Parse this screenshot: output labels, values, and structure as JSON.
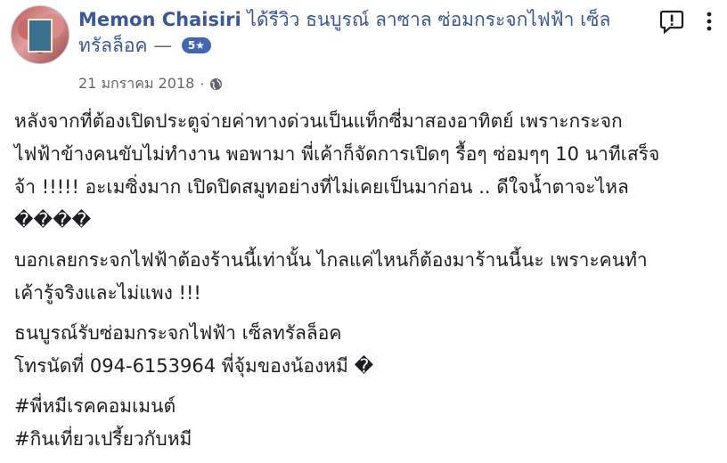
{
  "post": {
    "author_name": "Memon Chaisiri",
    "review_prefix": "ได้รีวิว ธนบูรณ์ ลาซาล ซ่อมกระจกไฟฟ้า เซ็ล",
    "review_suffix": "ทรัลล็อค",
    "rating_dash": "—",
    "rating_badge": "5★",
    "date": "21 มกราคม 2018",
    "dot": "·",
    "privacy_icon": "globe-icon",
    "report_icon": "report-icon",
    "more_icon": "more-vertical-icon"
  },
  "body": {
    "paragraph1": [
      "หลังจากที่ต้องเปิดประตูจ่ายค่าทางด่วนเป็นแท็กซี่มาสองอาทิตย์ เพราะกระจก",
      "ไฟฟ้าข้างคนขับไม่ทำงาน พอพามา พี่เค้าก็จัดการเปิดๆ รื้อๆ ซ่อมๆๆ 10 นาทีเสร็จ",
      "จ้า !!!!! อะเมซิ่งมาก เปิดปิดสมูทอย่างที่ไม่เคยเป็นมาก่อน .. ดีใจน้ำตาจะไหล",
      "����"
    ],
    "paragraph2": [
      "บอกเลยกระจกไฟฟ้าต้องร้านนี้เท่านั้น ไกลแค่ไหนก็ต้องมาร้านนี้นะ เพราะคนทำ",
      "เค้ารู้จริงและไม่แพง !!!"
    ],
    "paragraph3": [
      "ธนบูรณ์รับซ่อมกระจกไฟฟ้า เซ็ลทรัลล็อค",
      "โทรนัดที่ 094-6153964 พี่จุ้มของน้องหมี �"
    ],
    "hashtags": [
      "#พี่หมีเรคคอมเมนต์",
      "#กินเที่ยวเปรี้ยวกับหมี"
    ]
  },
  "colors": {
    "link": "#385898",
    "text": "#1c1e21",
    "meta": "#616770",
    "badge": "#4267b2"
  }
}
